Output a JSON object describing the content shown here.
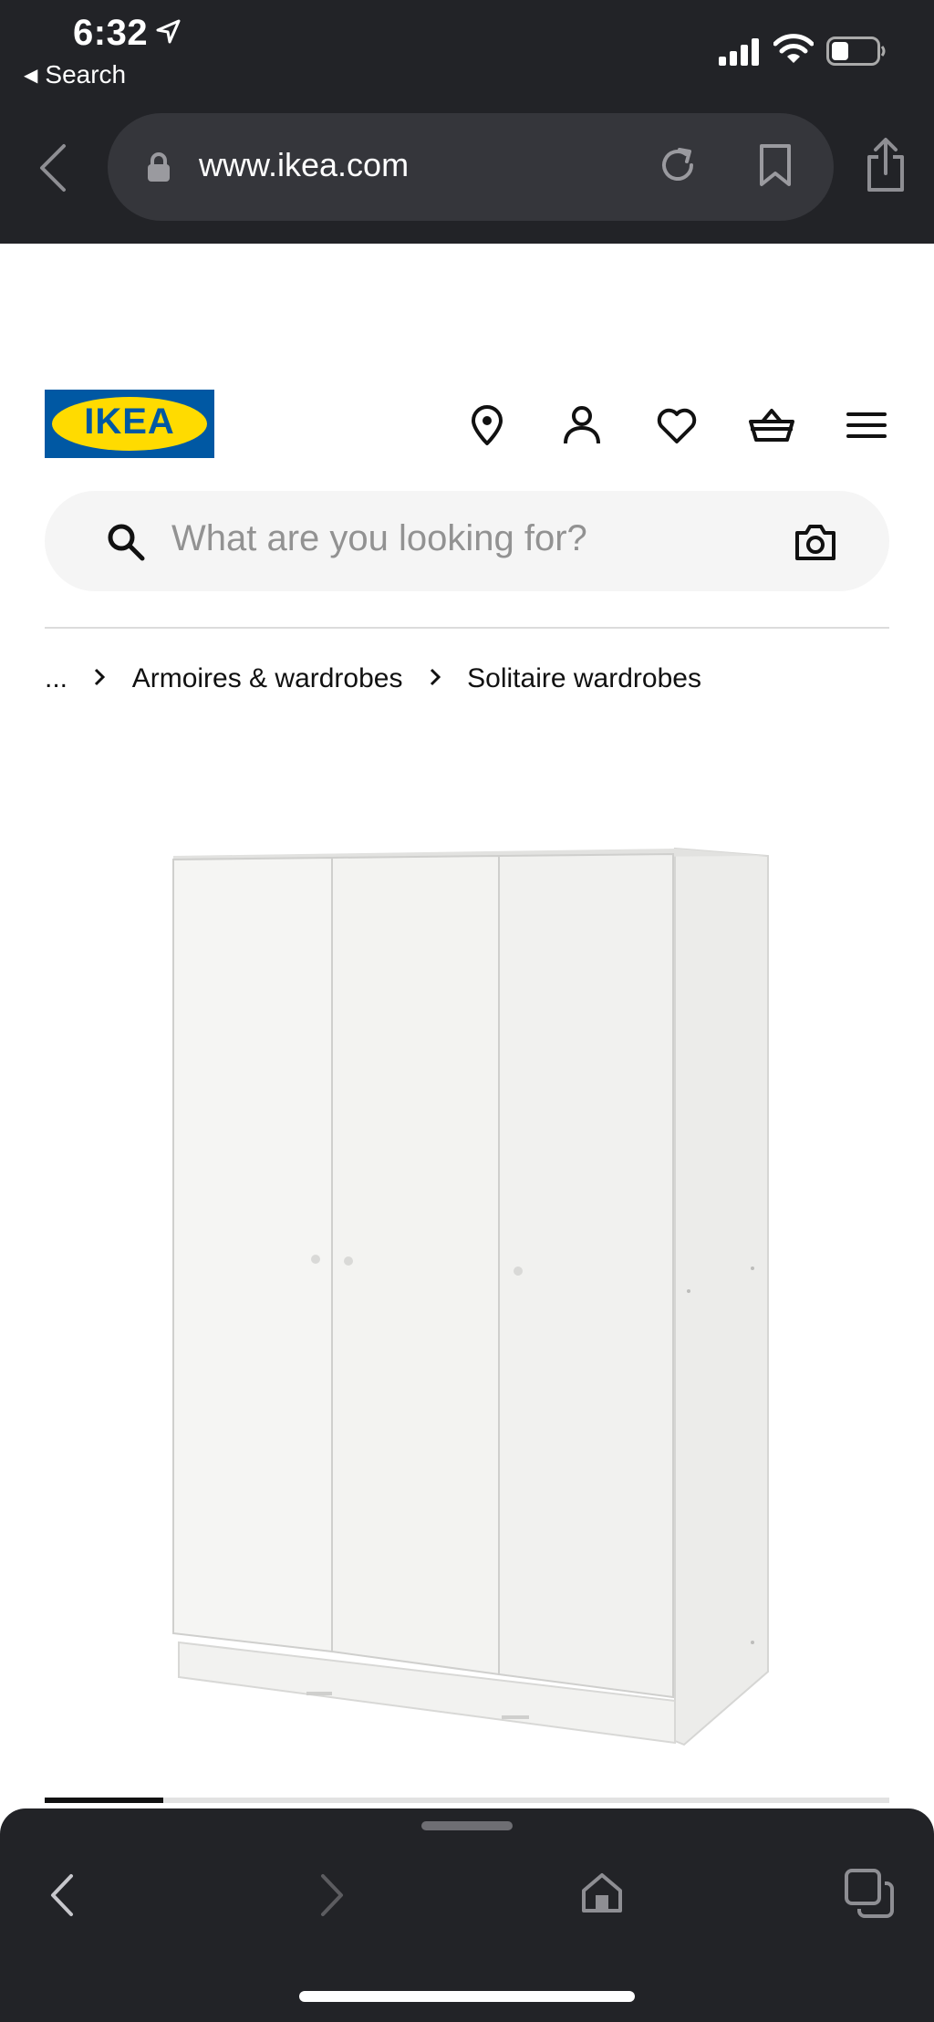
{
  "status_bar": {
    "time": "6:32",
    "back_app_label": "Search"
  },
  "browser": {
    "url": "www.ikea.com"
  },
  "header": {
    "logo_text": "IKEA",
    "icons": [
      "location-pin-icon",
      "account-icon",
      "heart-icon",
      "basket-icon",
      "hamburger-menu-icon"
    ]
  },
  "search": {
    "placeholder": "What are you looking for?"
  },
  "breadcrumb": {
    "items": [
      "...",
      "Armoires & wardrobes",
      "Solitaire wardrobes"
    ]
  },
  "carousel": {
    "position_fraction": 0.14
  },
  "colors": {
    "chrome": "#222327",
    "ikea_blue": "#0058a3",
    "ikea_yellow": "#ffdb00"
  }
}
